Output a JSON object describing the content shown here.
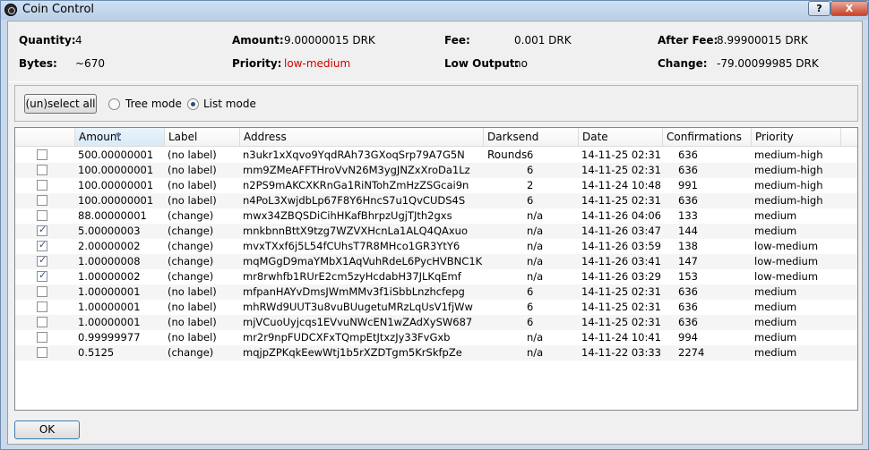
{
  "window": {
    "title": "Coin Control",
    "help_label": "?",
    "close_label": "X"
  },
  "summary": {
    "quantity_label": "Quantity:",
    "quantity_value": "4",
    "bytes_label": "Bytes:",
    "bytes_value": "~670",
    "amount_label": "Amount:",
    "amount_value": "9.00000015 DRK",
    "priority_label": "Priority:",
    "priority_value": "low-medium",
    "fee_label": "Fee:",
    "fee_value": "0.001 DRK",
    "low_output_label": "Low Output:",
    "low_output_value": "no",
    "after_fee_label": "After Fee:",
    "after_fee_value": "8.99900015 DRK",
    "change_label": "Change:",
    "change_value": "-79.00099985 DRK"
  },
  "controls": {
    "select_all_label": "(un)select all",
    "tree_mode_label": "Tree mode",
    "list_mode_label": "List mode",
    "selected_mode": "list"
  },
  "table": {
    "columns": [
      "Amount",
      "Label",
      "Address",
      "Darksend Rounds",
      "Date",
      "Confirmations",
      "Priority"
    ],
    "sort_column": "Amount",
    "rows": [
      {
        "checked": false,
        "amount": "500.00000001",
        "label": "(no label)",
        "address": "n3ukr1xXqvo9YqdRAh73GXoqSrp79A7G5N",
        "rounds": "6",
        "date": "14-11-25 02:31",
        "confirmations": "636",
        "priority": "medium-high"
      },
      {
        "checked": false,
        "amount": "100.00000001",
        "label": "(no label)",
        "address": "mm9ZMeAFFTHroVvN26M3ygJNZxXroDa1Lz",
        "rounds": "6",
        "date": "14-11-25 02:31",
        "confirmations": "636",
        "priority": "medium-high"
      },
      {
        "checked": false,
        "amount": "100.00000001",
        "label": "(no label)",
        "address": "n2PS9mAKCXKRnGa1RiNTohZmHzZSGcai9n",
        "rounds": "2",
        "date": "14-11-24 10:48",
        "confirmations": "991",
        "priority": "medium-high"
      },
      {
        "checked": false,
        "amount": "100.00000001",
        "label": "(no label)",
        "address": "n4PoL3XwjdbLp67F8Y6HncS7u1QvCUDS4S",
        "rounds": "6",
        "date": "14-11-25 02:31",
        "confirmations": "636",
        "priority": "medium-high"
      },
      {
        "checked": false,
        "amount": "88.00000001",
        "label": "(change)",
        "address": "mwx34ZBQSDiCihHKafBhrpzUgjTJth2gxs",
        "rounds": "n/a",
        "date": "14-11-26 04:06",
        "confirmations": "133",
        "priority": "medium"
      },
      {
        "checked": true,
        "amount": "5.00000003",
        "label": "(change)",
        "address": "mnkbnnBttX9tzg7WZVXHcnLa1ALQ4QAxuo",
        "rounds": "n/a",
        "date": "14-11-26 03:47",
        "confirmations": "144",
        "priority": "medium"
      },
      {
        "checked": true,
        "amount": "2.00000002",
        "label": "(change)",
        "address": "mvxTXxf6j5L54fCUhsT7R8MHco1GR3YtY6",
        "rounds": "n/a",
        "date": "14-11-26 03:59",
        "confirmations": "138",
        "priority": "low-medium"
      },
      {
        "checked": true,
        "amount": "1.00000008",
        "label": "(change)",
        "address": "mqMGgD9maYMbX1AqVuhRdeL6PycHVBNC1K",
        "rounds": "n/a",
        "date": "14-11-26 03:41",
        "confirmations": "147",
        "priority": "low-medium"
      },
      {
        "checked": true,
        "amount": "1.00000002",
        "label": "(change)",
        "address": "mr8rwhfb1RUrE2cm5zyHcdabH37JLKqEmf",
        "rounds": "n/a",
        "date": "14-11-26 03:29",
        "confirmations": "153",
        "priority": "low-medium"
      },
      {
        "checked": false,
        "amount": "1.00000001",
        "label": "(no label)",
        "address": "mfpanHAYvDmsJWmMMv3f1iSbbLnzhcfepg",
        "rounds": "6",
        "date": "14-11-25 02:31",
        "confirmations": "636",
        "priority": "medium"
      },
      {
        "checked": false,
        "amount": "1.00000001",
        "label": "(no label)",
        "address": "mhRWd9UUT3u8vuBUugetuMRzLqUsV1fjWw",
        "rounds": "6",
        "date": "14-11-25 02:31",
        "confirmations": "636",
        "priority": "medium"
      },
      {
        "checked": false,
        "amount": "1.00000001",
        "label": "(no label)",
        "address": "mjVCuoUyjcqs1EVvuNWcEN1wZAdXySW687",
        "rounds": "6",
        "date": "14-11-25 02:31",
        "confirmations": "636",
        "priority": "medium"
      },
      {
        "checked": false,
        "amount": "0.99999977",
        "label": "(no label)",
        "address": "mr2r9npFUDCXFxTQmpEtJtxzJy33FvGxb",
        "rounds": "n/a",
        "date": "14-11-24 10:41",
        "confirmations": "994",
        "priority": "medium"
      },
      {
        "checked": false,
        "amount": "0.5125",
        "label": "(change)",
        "address": "mqjpZPKqkEewWtj1b5rXZDTgm5KrSkfpZe",
        "rounds": "n/a",
        "date": "14-11-22 03:33",
        "confirmations": "2274",
        "priority": "medium"
      }
    ]
  },
  "footer": {
    "ok_label": "OK"
  },
  "colors": {
    "priority_warning": "#cc0000"
  }
}
